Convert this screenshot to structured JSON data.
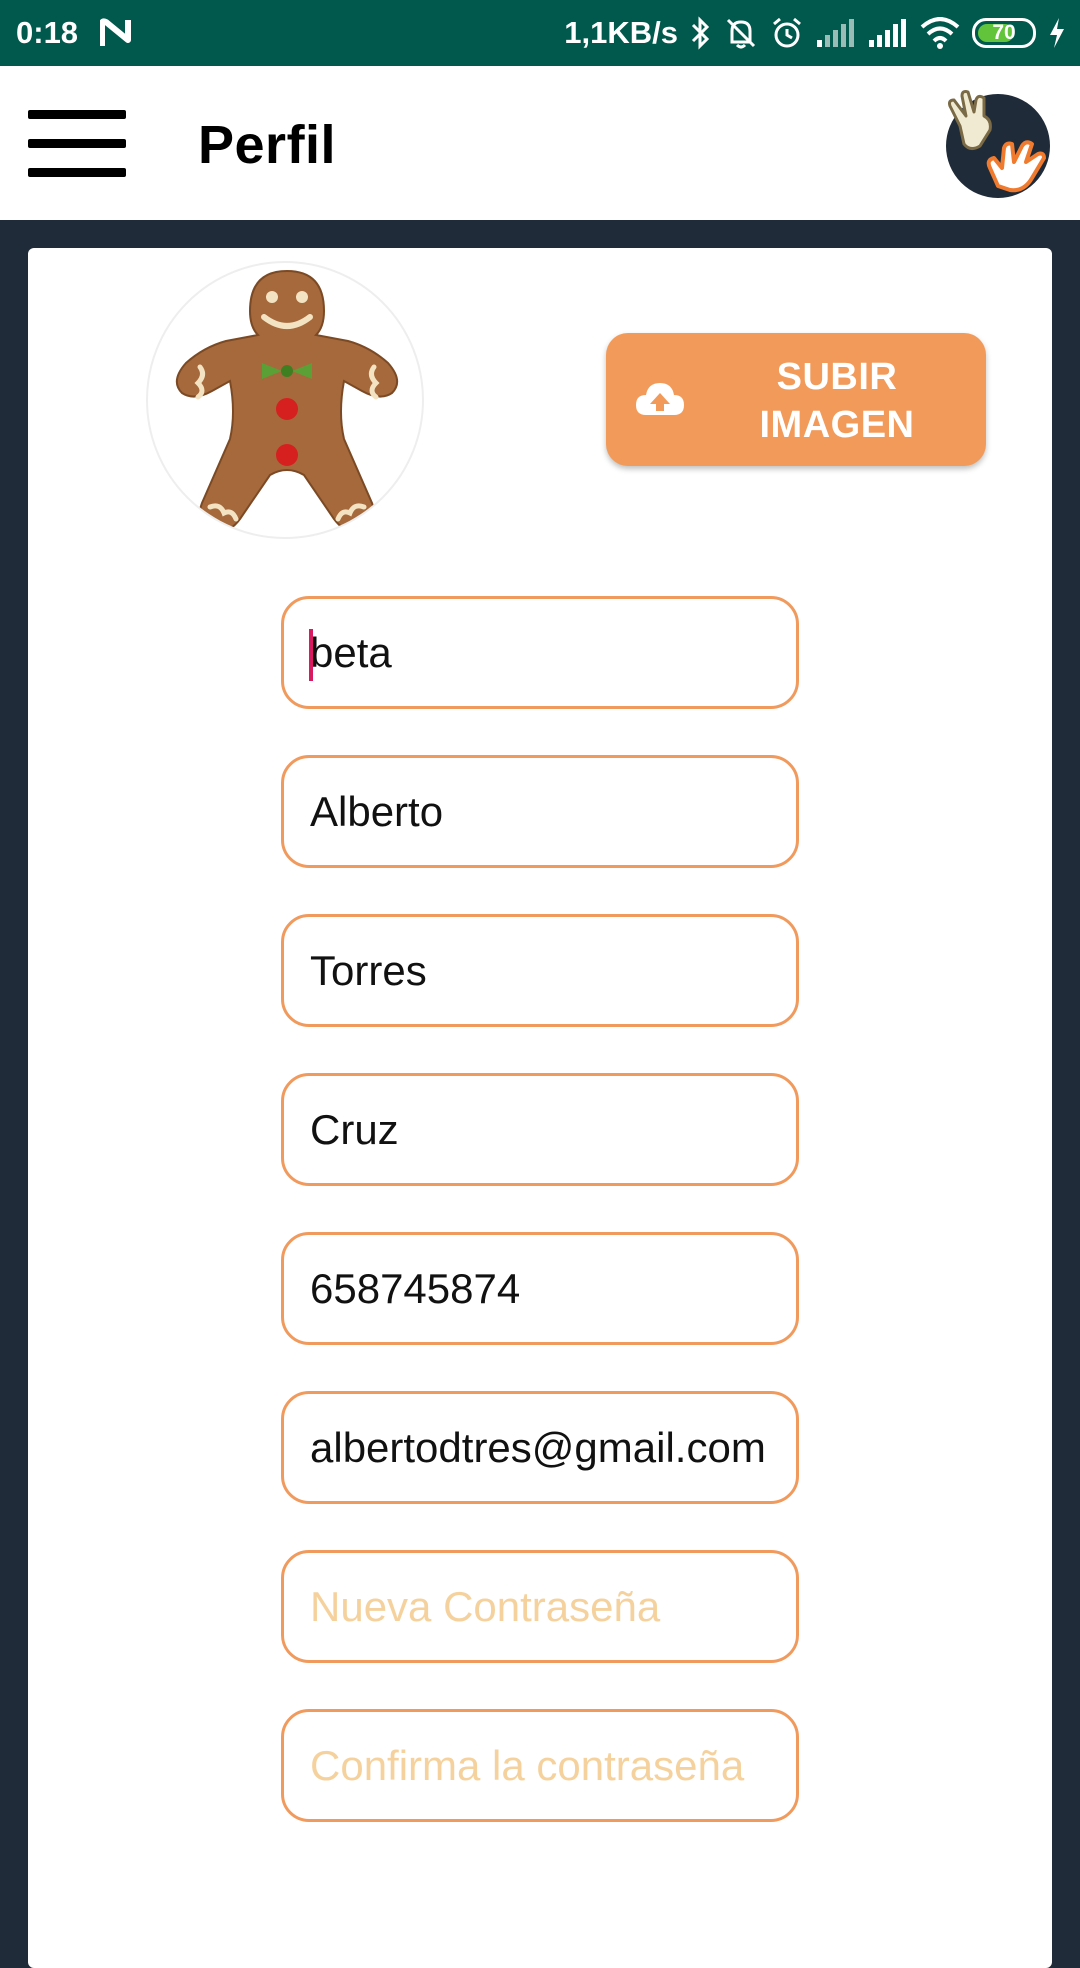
{
  "status_bar": {
    "time": "0:18",
    "network_speed": "1,1KB/s",
    "battery_level": "70",
    "battery_color": "#62c43a",
    "icons": [
      "n-notification-icon",
      "bluetooth-icon",
      "bell-off-icon",
      "alarm-icon",
      "signal-icon",
      "signal-icon",
      "wifi-icon",
      "battery-icon",
      "charging-icon"
    ]
  },
  "app_bar": {
    "title": "Perfil",
    "menu_icon": "hamburger-menu-icon",
    "logo_icon": "hands-logo-icon"
  },
  "profile": {
    "avatar_icon": "gingerbread-avatar-icon",
    "upload_button": {
      "label": "SUBIR\nIMAGEN",
      "icon": "cloud-upload-icon",
      "color": "#f29a5a"
    }
  },
  "form": {
    "fields": [
      {
        "value": "beta",
        "placeholder": ""
      },
      {
        "value": "Alberto",
        "placeholder": ""
      },
      {
        "value": "Torres",
        "placeholder": ""
      },
      {
        "value": "Cruz",
        "placeholder": ""
      },
      {
        "value": "658745874",
        "placeholder": ""
      },
      {
        "value": "albertodtres@gmail.com",
        "placeholder": ""
      },
      {
        "value": "",
        "placeholder": "Nueva Contraseña"
      },
      {
        "value": "",
        "placeholder": "Confirma la contraseña"
      }
    ],
    "border_color": "#f19a5e",
    "placeholder_color": "#f5d29d"
  }
}
